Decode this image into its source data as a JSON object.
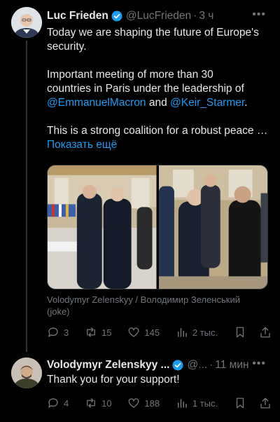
{
  "tweets": [
    {
      "author_name": "Luc Frieden",
      "handle": "@LucFrieden",
      "separator": "·",
      "time": "3 ч",
      "text_line1": "Today we are shaping the future of Europe's",
      "text_line2": "security.",
      "text_line3": "Important meeting of more than 30",
      "text_line4": "countries in Paris under the leadership of",
      "mention1": "@EmmanuelMacron",
      "and": " and ",
      "mention2": "@Keir_Starmer",
      "period": ".",
      "text_line6": "This is a strong coalition for a robust peace …",
      "show_more": "Показать ещё",
      "caption_line1": "Volodymyr Zelenskyy / Володимир Зеленський",
      "caption_line2": "(joke)",
      "replies": "3",
      "reposts": "15",
      "likes": "145",
      "views": "2 тыс."
    },
    {
      "author_name": "Volodymyr Zelenskyy ...",
      "handle": "@...",
      "separator": "·",
      "time": "11 мин",
      "text": "Thank you for your support!",
      "replies": "4",
      "reposts": "10",
      "likes": "188",
      "views": "1 тыс."
    }
  ],
  "colors": {
    "background": "#000000",
    "text": "#e7e9ea",
    "muted": "#71767b",
    "link": "#1d9bf0",
    "verified": "#1d9bf0"
  },
  "icons": [
    "reply-icon",
    "repost-icon",
    "like-icon",
    "views-icon",
    "bookmark-icon",
    "share-icon",
    "verified-icon",
    "more-icon"
  ]
}
